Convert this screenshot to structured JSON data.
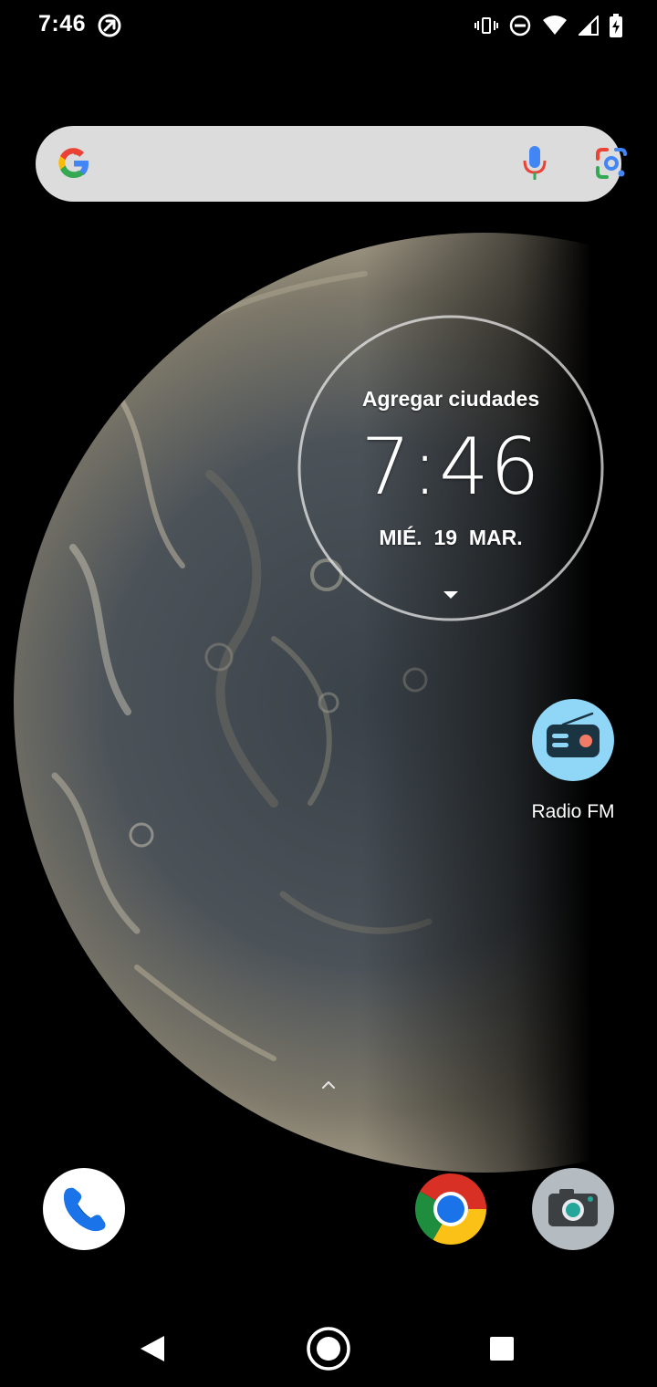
{
  "status_bar": {
    "time": "7:46",
    "left_icon": "assistant-status-icon",
    "right_icons": [
      "vibrate-icon",
      "do-not-disturb-icon",
      "wifi-icon",
      "cell-signal-icon",
      "battery-charging-icon"
    ]
  },
  "search_bar": {
    "logo": "google-g-icon",
    "mic_icon": "mic-icon",
    "lens_icon": "google-lens-icon"
  },
  "clock_widget": {
    "city_label": "Agregar ciudades",
    "time": "7:46",
    "date": "MIÉ.  19  MAR."
  },
  "apps": {
    "radio": {
      "label": "Radio FM",
      "icon": "radio-icon",
      "color": "#8fd6f7"
    }
  },
  "dock": {
    "apps": [
      {
        "name": "phone",
        "icon": "phone-icon"
      },
      {
        "name": "chrome",
        "icon": "chrome-icon"
      },
      {
        "name": "camera",
        "icon": "camera-icon"
      }
    ]
  },
  "nav_bar": {
    "back": "back-icon",
    "home": "home-icon",
    "recents": "recents-icon"
  }
}
